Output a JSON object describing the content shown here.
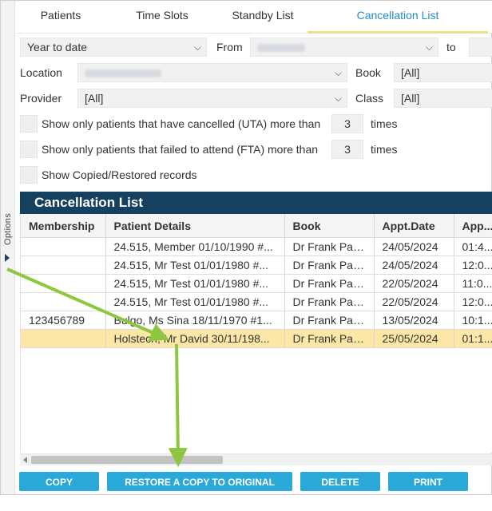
{
  "tabs": [
    {
      "label": "Patients",
      "active": false
    },
    {
      "label": "Time Slots",
      "active": false
    },
    {
      "label": "Standby List",
      "active": false
    },
    {
      "label": "Cancellation List",
      "active": true
    }
  ],
  "rail": {
    "label": "Options"
  },
  "filters": {
    "period": "Year to date",
    "from_label": "From",
    "to_label": "to",
    "location_label": "Location",
    "book_label": "Book",
    "book_value": "[All]",
    "provider_label": "Provider",
    "provider_value": "[All]",
    "class_label": "Class",
    "class_value": "[All]",
    "uta_label": "Show only patients that have cancelled (UTA) more than",
    "uta_value": "3",
    "fta_label": "Show only patients that failed to attend (FTA) more than",
    "fta_value": "3",
    "times_label": "times",
    "copied_label": "Show Copied/Restored records"
  },
  "grid": {
    "title": "Cancellation List",
    "columns": [
      "Membership",
      "Patient Details",
      "Book",
      "Appt.Date",
      "App..."
    ],
    "rows": [
      {
        "membership": "",
        "patient": "24.515, Member 01/10/1990 #...",
        "book": "Dr Frank Pap...",
        "date": "24/05/2024",
        "time": "01:4...",
        "selected": false
      },
      {
        "membership": "",
        "patient": "24.515, Mr Test 01/01/1980 #...",
        "book": "Dr Frank Pap...",
        "date": "24/05/2024",
        "time": "12:0...",
        "selected": false
      },
      {
        "membership": "",
        "patient": "24.515, Mr Test 01/01/1980 #...",
        "book": "Dr Frank Pap...",
        "date": "22/05/2024",
        "time": "11:0...",
        "selected": false
      },
      {
        "membership": "",
        "patient": "24.515, Mr Test 01/01/1980 #...",
        "book": "Dr Frank Pap...",
        "date": "22/05/2024",
        "time": "12:0...",
        "selected": false
      },
      {
        "membership": "123456789",
        "patient": "Bulgo, Ms Sina 18/11/1970 #1...",
        "book": "Dr Frank Pap...",
        "date": "13/05/2024",
        "time": "10:1...",
        "selected": false
      },
      {
        "membership": "",
        "patient": "Holstech, Mr David 30/11/198...",
        "book": "Dr Frank Pap...",
        "date": "25/05/2024",
        "time": "01:1...",
        "selected": true
      }
    ]
  },
  "buttons": {
    "copy": "COPY",
    "restore": "RESTORE A COPY TO ORIGINAL SLOT(S)",
    "delete": "DELETE",
    "print": "PRINT"
  },
  "colors": {
    "accent": "#2aa8d8",
    "header_bar": "#16405f",
    "selected_row": "#fde7a6",
    "annotation_arrow": "#8dc63f",
    "active_tab_text": "#2a88c7"
  }
}
